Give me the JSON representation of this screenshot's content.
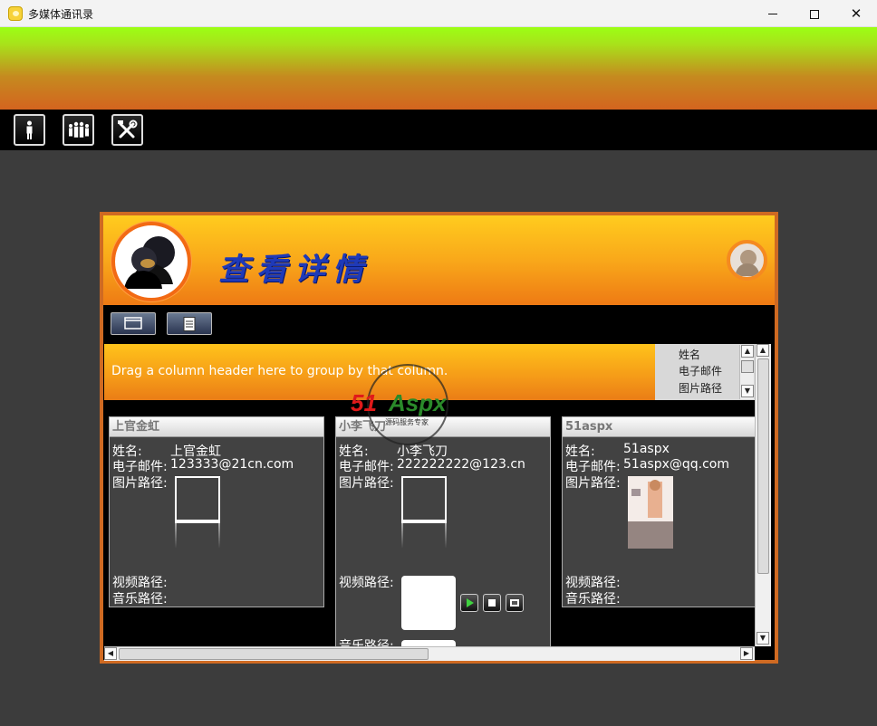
{
  "window": {
    "title": "多媒体通讯录",
    "controls": {
      "minimize": "minimize",
      "maximize": "maximize",
      "close": "✕"
    }
  },
  "toolbar": {
    "buttons": [
      {
        "icon": "person-icon"
      },
      {
        "icon": "group-icon"
      },
      {
        "icon": "tools-icon"
      }
    ]
  },
  "details": {
    "title": "查看详情",
    "toolbar_buttons": [
      {
        "icon": "window-icon"
      },
      {
        "icon": "document-icon"
      }
    ],
    "groupby_hint": "Drag a column header here to group by that column.",
    "field_chooser": [
      "姓名",
      "电子邮件",
      "图片路径"
    ],
    "labels": {
      "name": "姓名:",
      "email": "电子邮件:",
      "image_path": "图片路径:",
      "video_path": "视频路径:",
      "music_path": "音乐路径:"
    },
    "cards": [
      {
        "header": "上官金虹",
        "name": "上官金虹",
        "email": "123333@21cn.com"
      },
      {
        "header": "小李飞刀",
        "name": "小李飞刀",
        "email": "222222222@123.cn"
      },
      {
        "header": "51aspx",
        "name": "51aspx",
        "email": "51aspx@qq.com"
      }
    ]
  },
  "watermark": {
    "brand_red": "51",
    "brand_green": "Aspx",
    "tagline": "源码服务专家"
  }
}
